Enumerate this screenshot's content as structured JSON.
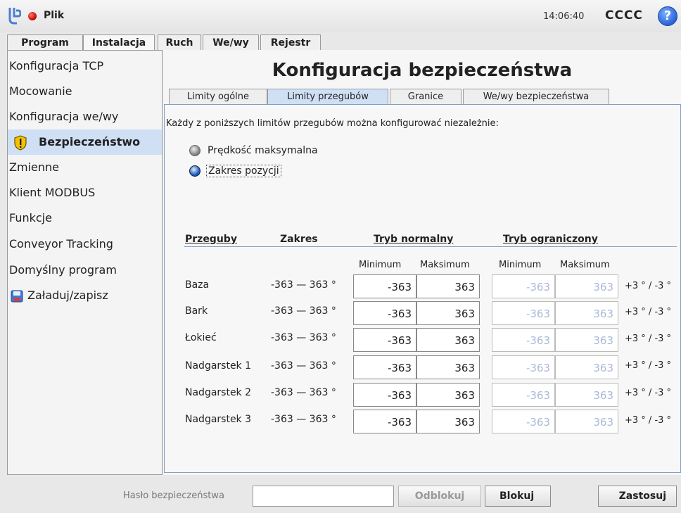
{
  "topbar": {
    "menu_label": "Plik",
    "time": "14:06:40",
    "robot_name": "CCCC",
    "help_icon": "?"
  },
  "main_tabs": [
    "Program",
    "Instalacja",
    "Ruch",
    "We/wy",
    "Rejestr"
  ],
  "sidebar": {
    "items": [
      {
        "label": "Konfiguracja TCP"
      },
      {
        "label": "Mocowanie"
      },
      {
        "label": "Konfiguracja we/wy"
      },
      {
        "label": "Bezpieczeństwo",
        "icon": "shield-warning-icon",
        "selected": true
      },
      {
        "label": "Zmienne"
      },
      {
        "label": "Klient MODBUS"
      },
      {
        "label": "Funkcje"
      },
      {
        "label": "Conveyor Tracking"
      },
      {
        "label": "Domyślny program"
      },
      {
        "label": "Załaduj/zapisz",
        "icon": "save-disk-icon"
      }
    ]
  },
  "main": {
    "title": "Konfiguracja bezpieczeństwa",
    "sub_tabs": [
      "Limity ogólne",
      "Limity przegubów",
      "Granice",
      "We/wy bezpieczeństwa"
    ],
    "description": "Każdy z poniższych limitów przegubów można konfigurować niezależnie:",
    "radio_options": [
      {
        "label": "Prędkość maksymalna",
        "selected": false
      },
      {
        "label": "Zakres pozycji",
        "selected": true
      }
    ],
    "table": {
      "headers": {
        "joints": "Przeguby",
        "range": "Zakres",
        "normal": "Tryb normalny",
        "reduced": "Tryb ograniczony"
      },
      "subheaders": {
        "normal_min": "Minimum",
        "normal_max": "Maksimum",
        "reduced_min": "Minimum",
        "reduced_max": "Maksimum"
      },
      "rows": [
        {
          "name": "Baza",
          "range": "-363 — 363 °",
          "normal_min": "-363",
          "normal_max": "363",
          "reduced_min": "-363",
          "reduced_max": "363",
          "tolerance": "+3 ° / -3 °"
        },
        {
          "name": "Bark",
          "range": "-363 — 363 °",
          "normal_min": "-363",
          "normal_max": "363",
          "reduced_min": "-363",
          "reduced_max": "363",
          "tolerance": "+3 ° / -3 °"
        },
        {
          "name": "Łokieć",
          "range": "-363 — 363 °",
          "normal_min": "-363",
          "normal_max": "363",
          "reduced_min": "-363",
          "reduced_max": "363",
          "tolerance": "+3 ° / -3 °"
        },
        {
          "name": "Nadgarstek 1",
          "range": "-363 — 363 °",
          "normal_min": "-363",
          "normal_max": "363",
          "reduced_min": "-363",
          "reduced_max": "363",
          "tolerance": "+3 ° / -3 °"
        },
        {
          "name": "Nadgarstek 2",
          "range": "-363 — 363 °",
          "normal_min": "-363",
          "normal_max": "363",
          "reduced_min": "-363",
          "reduced_max": "363",
          "tolerance": "+3 ° / -3 °"
        },
        {
          "name": "Nadgarstek 3",
          "range": "-363 — 363 °",
          "normal_min": "-363",
          "normal_max": "363",
          "reduced_min": "-363",
          "reduced_max": "363",
          "tolerance": "+3 ° / -3 °"
        }
      ]
    }
  },
  "footer": {
    "password_label": "Hasło bezpieczeństwa",
    "password_value": "",
    "unlock_label": "Odblokuj",
    "lock_label": "Blokuj",
    "apply_label": "Zastosuj"
  }
}
